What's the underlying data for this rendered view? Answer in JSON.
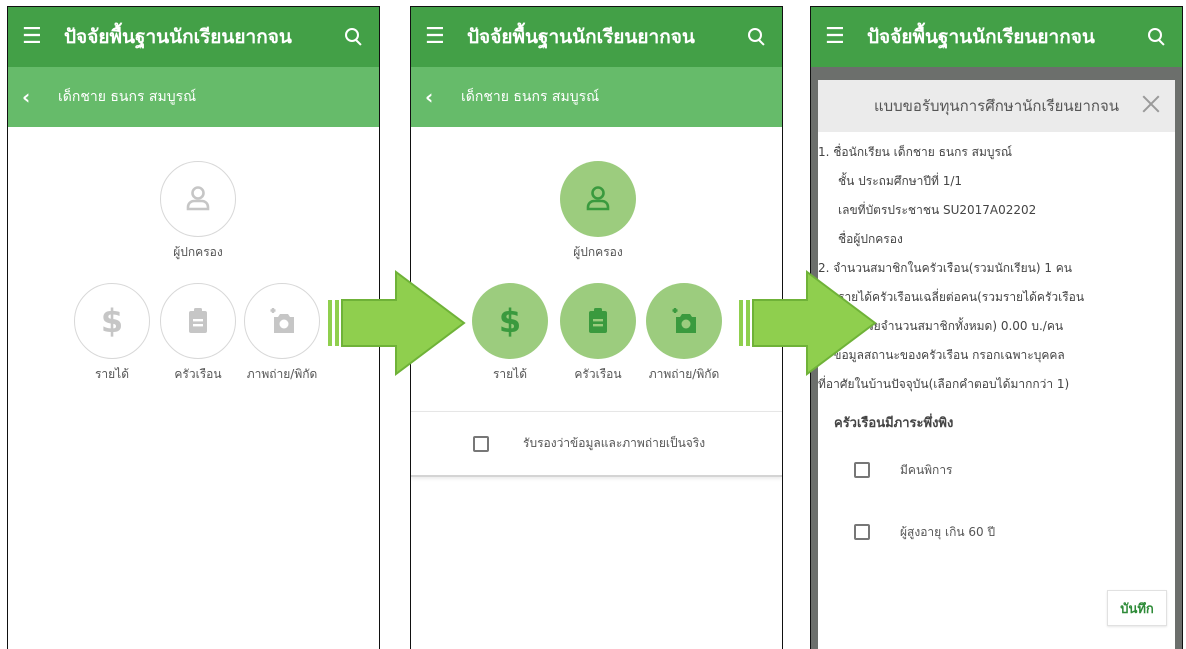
{
  "app": {
    "title": "ปัจจัยพื้นฐานนักเรียนยากจน",
    "student_name": "เด็กชาย ธนกร สมบูรณ์"
  },
  "colors": {
    "appbar": "#43a047",
    "subbar": "#66bb6a",
    "icon_filled_bg": "#9ccc7e",
    "icon_fg": "#3a9a3e",
    "arrow": "#8fcf4e"
  },
  "icons": [
    "menu-icon",
    "search-icon",
    "back-arrow-icon",
    "person-icon",
    "dollar-icon",
    "clipboard-icon",
    "add-photo-icon",
    "close-icon"
  ],
  "menu_items": {
    "guardian": "ผู้ปกครอง",
    "income": "รายได้",
    "household": "ครัวเรือน",
    "photo": "ภาพถ่าย/พิกัด"
  },
  "confirm_label": "รับรองว่าข้อมูลและภาพถ่ายเป็นจริง",
  "dialog": {
    "title": "แบบขอรับทุนการศึกษานักเรียนยากจน",
    "lines": [
      "1. ชื่อนักเรียน เด็กชาย ธนกร สมบูรณ์",
      "ชั้น ประถมศึกษาปีที่ 1/1",
      "เลขที่บัตรประชาชน SU2017A02202",
      "ชื่อผู้ปกครอง",
      "2. จำนวนสมาชิกในครัวเรือน(รวมนักเรียน) 1 คน",
      "รายได้ครัวเรือนเฉลี่ยต่อคน(รวมรายได้ครัวเรือน",
      "หารด้วยจำนวนสมาชิกทั้งหมด) 0.00 บ./คน",
      "3. ข้อมูลสถานะของครัวเรือน กรอกเฉพาะบุคคล",
      "ที่อาศัยในบ้านปัจจุบัน(เลือกคำตอบได้มากกว่า 1)"
    ],
    "section_title": "ครัวเรือนมีภาระพึ่งพิง",
    "options": [
      "มีคนพิการ",
      "ผู้สูงอายุ เกิน 60 ปี"
    ],
    "save_label": "บันทึก"
  }
}
